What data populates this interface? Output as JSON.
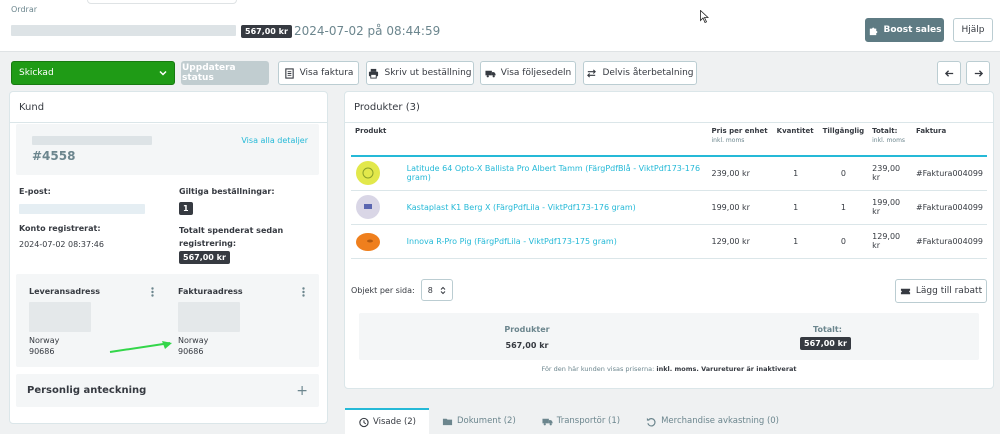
{
  "header": {
    "breadcrumb": "Ordrar",
    "order_total": "567,00 kr",
    "order_date": "2024-07-02 på 08:44:59",
    "boost_label": "Boost sales",
    "help_label": "Hjälp"
  },
  "actions": {
    "status_value": "Skickad",
    "update_status": "Uppdatera status",
    "view_invoice": "Visa faktura",
    "print_order": "Skriv ut beställning",
    "view_delivery_slip": "Visa följesedeln",
    "partial_refund": "Delvis återbetalning"
  },
  "customer": {
    "title": "Kund",
    "id": "#4558",
    "view_all": "Visa alla detaljer",
    "email_label": "E-post:",
    "valid_orders_label": "Giltiga beställningar:",
    "valid_orders_count": "1",
    "registered_label": "Konto registrerat:",
    "registered_value": "2024-07-02 08:37:46",
    "total_spent_label": "Totalt spenderat sedan registrering:",
    "total_spent_value": "567,00 kr",
    "shipping_address_label": "Leveransadress",
    "invoice_address_label": "Fakturaadress",
    "shipping_country": "Norway",
    "shipping_postcode": "90686",
    "invoice_country": "Norway",
    "invoice_postcode": "90686",
    "private_note_label": "Personlig anteckning",
    "add_symbol": "+"
  },
  "products": {
    "title": "Produkter (3)",
    "columns": {
      "product": "Produkt",
      "price": "Pris per enhet",
      "price_sub": "inkl. moms",
      "quantity": "Kvantitet",
      "available": "Tillgänglig",
      "total": "Totalt:",
      "total_sub": "inkl. moms",
      "invoice": "Faktura"
    },
    "rows": [
      {
        "name": "Latitude 64 Opto-X Ballista Pro Albert Tamm (FärgPdfBlå - ViktPdf173-176 gram)",
        "price": "239,00 kr",
        "qty": "1",
        "available": "0",
        "total": "239,00 kr",
        "invoice": "#Faktura004099",
        "thumb_color": "#e2e84b"
      },
      {
        "name": "Kastaplast K1 Berg X (FärgPdfLila - ViktPdf173-176 gram)",
        "price": "199,00 kr",
        "qty": "1",
        "available": "1",
        "total": "199,00 kr",
        "invoice": "#Faktura004099",
        "thumb_color": "#d9d6e6"
      },
      {
        "name": "Innova R-Pro Pig (FärgPdfLila - ViktPdf173-175 gram)",
        "price": "129,00 kr",
        "qty": "1",
        "available": "0",
        "total": "129,00 kr",
        "invoice": "#Faktura004099",
        "thumb_color": "#ef7f1d"
      }
    ],
    "per_page_label": "Objekt per sida:",
    "per_page_value": "8",
    "add_discount": "Lägg till rabatt",
    "summary_products_label": "Produkter",
    "summary_products_value": "567,00 kr",
    "summary_total_label": "Totalt:",
    "summary_total_value": "567,00 kr",
    "price_note_prefix": "För den här kunden visas priserna:",
    "price_note_bold": "inkl. moms. Varureturer är inaktiverat"
  },
  "tabs": [
    {
      "label": "Visade (2)"
    },
    {
      "label": "Dokument (2)"
    },
    {
      "label": "Transportör (1)"
    },
    {
      "label": "Merchandise avkastning (0)"
    }
  ]
}
